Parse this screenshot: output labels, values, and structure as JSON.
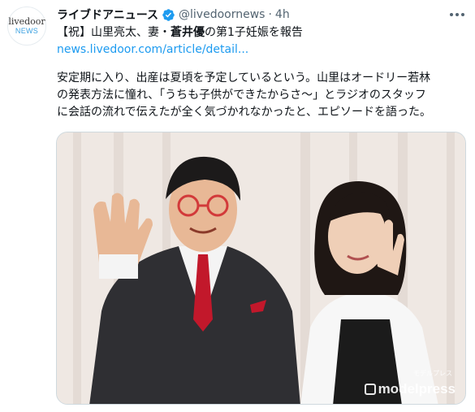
{
  "account": {
    "avatar_text_top": "livedoor",
    "avatar_text_bottom": "NEWS",
    "name": "ライブドアニュース",
    "handle": "@livedoornews",
    "separator": "·",
    "time": "4h",
    "verified_icon": "verified-badge-icon",
    "colors": {
      "verified": "#1d9bf0",
      "link": "#1d9bf0",
      "secondary_text": "#536471"
    }
  },
  "tweet": {
    "headline_a": "【祝】山里亮太、妻・",
    "headline_bold": "蒼井優",
    "headline_b": "の第1子妊娠を報告",
    "link": "news.livedoor.com/article/detail...",
    "paragraph_lines": [
      "安定期に入り、出産は夏頃を予定しているという。山里はオードリー若林",
      "の発表方法に憧れ、「うちも子供ができたからさ〜」とラジオのスタッフ",
      "に会話の流れで伝えたが全く気づかれなかったと、エピソードを語った。"
    ]
  },
  "media": {
    "watermark": "modelpress",
    "credit": "モデルプレス"
  }
}
